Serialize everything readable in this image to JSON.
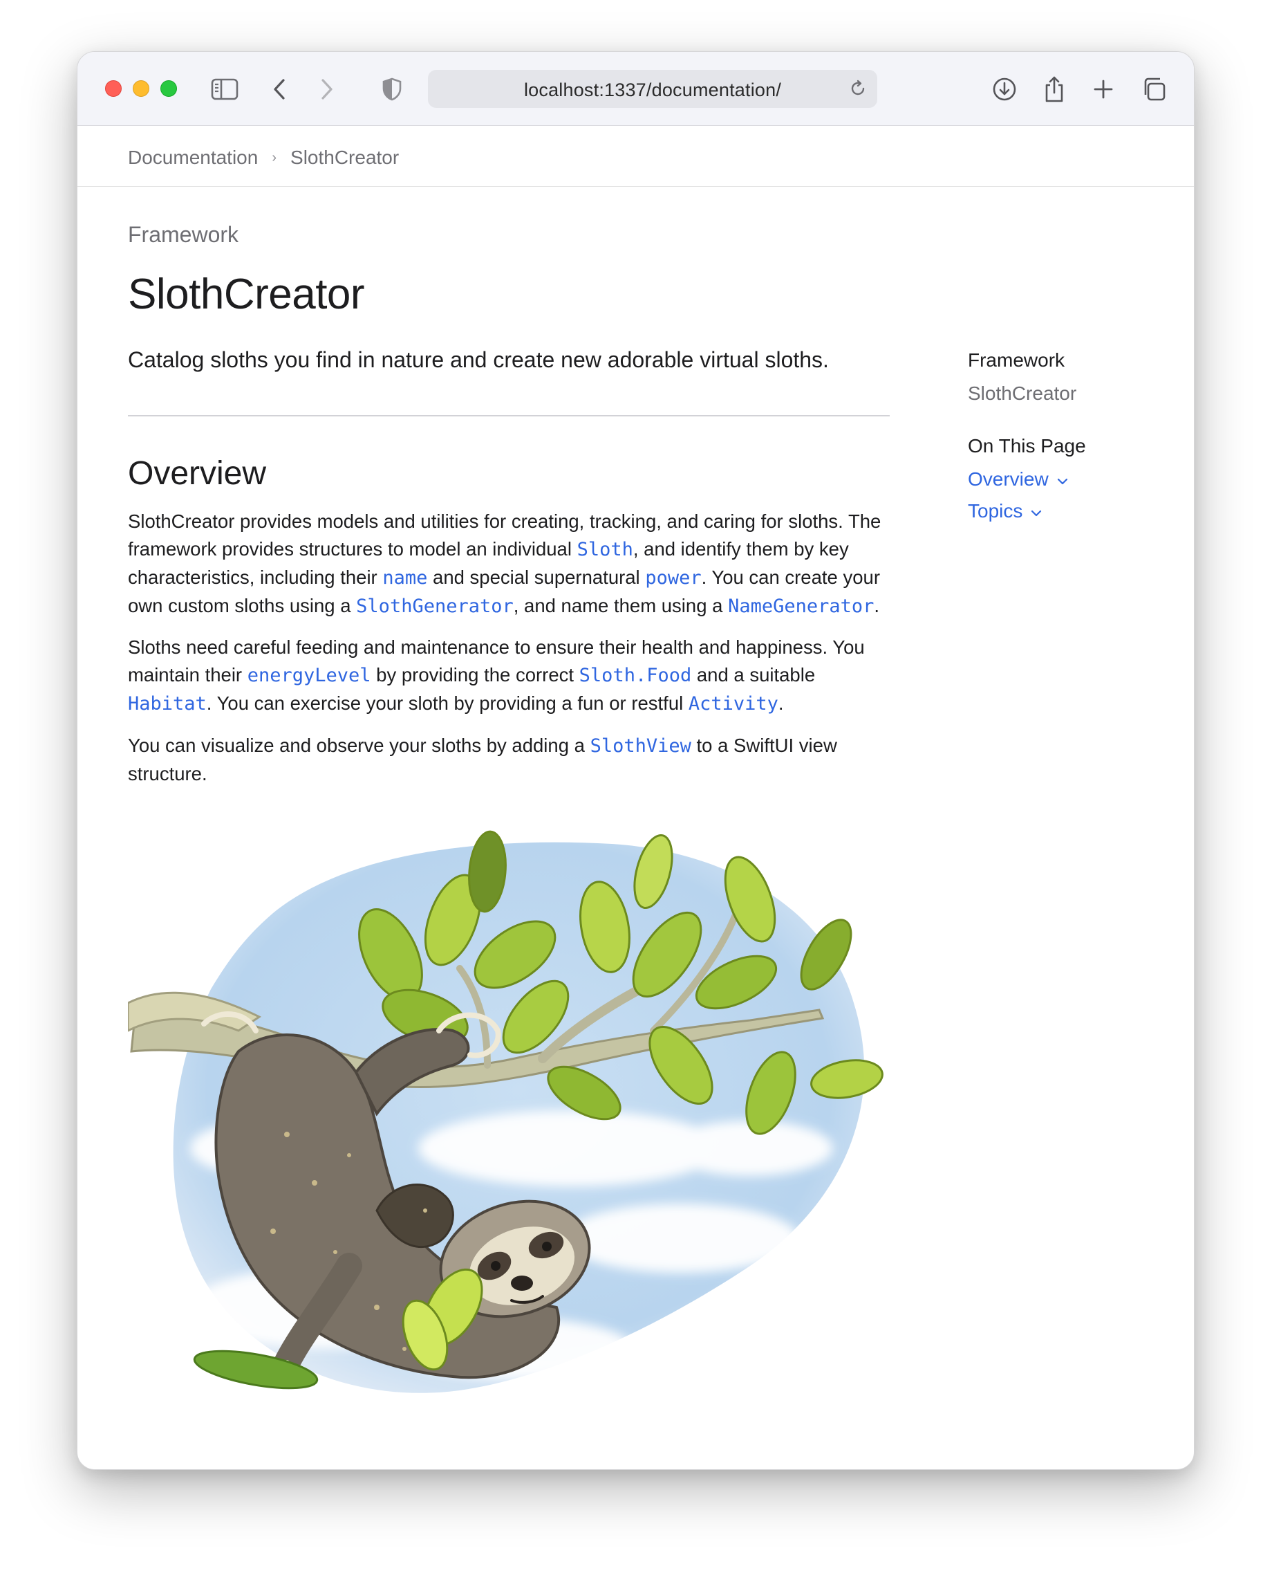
{
  "browser": {
    "url": "localhost:1337/documentation/"
  },
  "breadcrumb": {
    "items": [
      "Documentation",
      "SlothCreator"
    ],
    "separator": "›"
  },
  "page": {
    "eyebrow": "Framework",
    "title": "SlothCreator",
    "abstract": "Catalog sloths you find in nature and create new adorable virtual sloths."
  },
  "overview": {
    "heading": "Overview",
    "p1": {
      "t1": "SlothCreator provides models and utilities for creating, tracking, and caring for sloths. The framework provides structures to model an individual ",
      "s1": "Sloth",
      "t2": ", and identify them by key characteristics, including their ",
      "s2": "name",
      "t3": " and special supernatural ",
      "s3": "power",
      "t4": ". You can create your own custom sloths using a ",
      "s4": "SlothGenerator",
      "t5": ", and name them using a ",
      "s5": "NameGenerator",
      "t6": "."
    },
    "p2": {
      "t1": "Sloths need careful feeding and maintenance to ensure their health and happiness. You maintain their ",
      "s1": "energyLevel",
      "t2": " by providing the correct ",
      "s2": "Sloth.Food",
      "t3": " and a suitable ",
      "s3": "Habitat",
      "t4": ". You can exercise your sloth by providing a fun or restful ",
      "s4": "Activity",
      "t5": "."
    },
    "p3": {
      "t1": "You can visualize and observe your sloths by adding a ",
      "s1": "SlothView",
      "t2": " to a SwiftUI view structure."
    }
  },
  "sidebar": {
    "kind": "Framework",
    "module": "SlothCreator",
    "on_this_page_heading": "On This Page",
    "links": [
      "Overview",
      "Topics"
    ]
  },
  "colors": {
    "link": "#2f66e0",
    "text": "#1d1d1f",
    "secondary_text": "#6e6e73"
  },
  "icons": [
    "sidebar-icon",
    "back-icon",
    "forward-icon",
    "shield-icon",
    "reload-icon",
    "download-icon",
    "share-icon",
    "new-tab-icon",
    "tab-overview-icon",
    "chevron-down-icon"
  ]
}
